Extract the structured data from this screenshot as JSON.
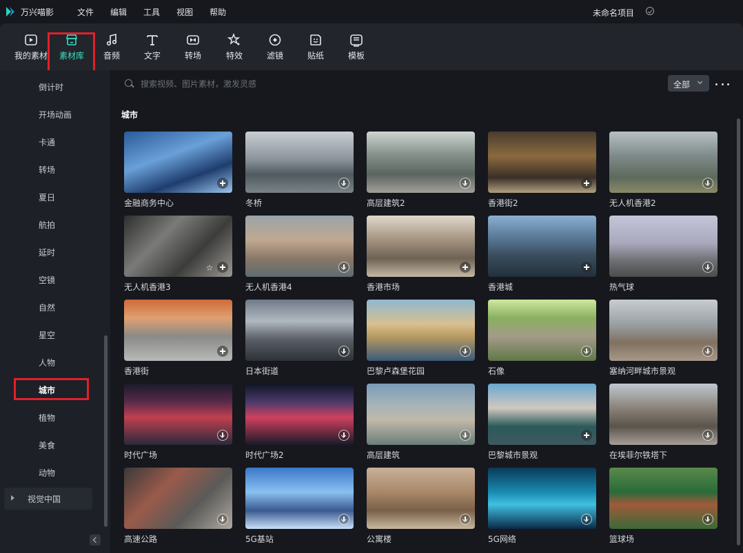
{
  "app": {
    "name": "万兴喵影",
    "menu": [
      "文件",
      "编辑",
      "工具",
      "视图",
      "帮助"
    ],
    "project_name": "未命名项目"
  },
  "toolbar": {
    "tools": [
      {
        "label": "我的素材",
        "icon": "media-icon"
      },
      {
        "label": "素材库",
        "icon": "store-icon",
        "active": true
      },
      {
        "label": "音频",
        "icon": "music-note-icon"
      },
      {
        "label": "文字",
        "icon": "text-icon"
      },
      {
        "label": "转场",
        "icon": "transition-icon"
      },
      {
        "label": "特效",
        "icon": "effects-icon"
      },
      {
        "label": "滤镜",
        "icon": "filter-icon"
      },
      {
        "label": "贴纸",
        "icon": "sticker-icon"
      },
      {
        "label": "模板",
        "icon": "template-icon"
      }
    ]
  },
  "sidebar": {
    "items": [
      "倒计时",
      "开场动画",
      "卡通",
      "转场",
      "夏日",
      "航拍",
      "延时",
      "空镜",
      "自然",
      "星空",
      "人物",
      "城市",
      "植物",
      "美食",
      "动物"
    ],
    "active_item": "城市",
    "group": "视觉中国"
  },
  "search": {
    "placeholder": "搜索视频、图片素材，激发灵感",
    "filter": "全部"
  },
  "section": {
    "title": "城市"
  },
  "colors": {
    "accent": "#39e0c0",
    "highlight": "#e3202a",
    "background": "#16181d",
    "panel": "#22252c"
  },
  "items": [
    {
      "label": "金融商务中心",
      "action": "plus"
    },
    {
      "label": "冬桥",
      "action": "download"
    },
    {
      "label": "高层建筑2",
      "action": "download"
    },
    {
      "label": "香港街2",
      "action": "plus"
    },
    {
      "label": "无人机香港2",
      "action": "download"
    },
    {
      "label": "无人机香港3",
      "action": "plus",
      "favorite": true
    },
    {
      "label": "无人机香港4",
      "action": "download"
    },
    {
      "label": "香港市场",
      "action": "plus"
    },
    {
      "label": "香港城",
      "action": "plus"
    },
    {
      "label": "热气球",
      "action": "download"
    },
    {
      "label": "香港街",
      "action": "plus"
    },
    {
      "label": "日本街道",
      "action": "download"
    },
    {
      "label": "巴黎卢森堡花园",
      "action": "download"
    },
    {
      "label": "石像",
      "action": "download"
    },
    {
      "label": "塞纳河畔城市景观",
      "action": "download"
    },
    {
      "label": "时代广场",
      "action": "download"
    },
    {
      "label": "时代广场2",
      "action": "download"
    },
    {
      "label": "高层建筑",
      "action": "download"
    },
    {
      "label": "巴黎城市景观",
      "action": "plus"
    },
    {
      "label": "在埃菲尔铁塔下",
      "action": "download"
    },
    {
      "label": "高速公路",
      "action": "download"
    },
    {
      "label": "5G基站",
      "action": "download"
    },
    {
      "label": "公寓楼",
      "action": "download"
    },
    {
      "label": "5G网络",
      "action": "download"
    },
    {
      "label": "篮球场",
      "action": "download"
    }
  ]
}
